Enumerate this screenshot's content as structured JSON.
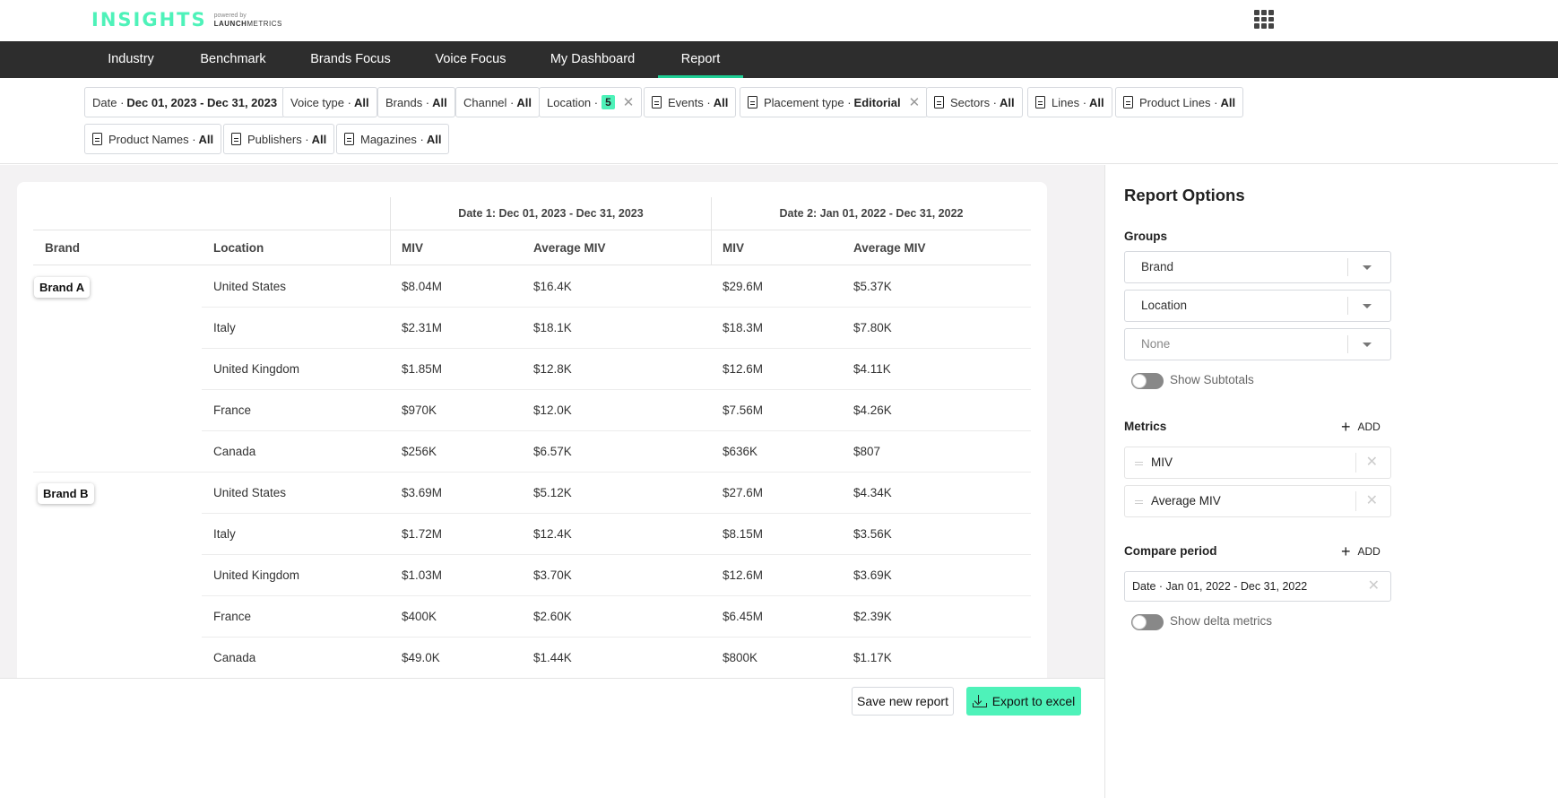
{
  "app": {
    "logo_word": "INSIGHTS",
    "logo_powered": "powered by",
    "logo_brand_bold": "LAUNCH",
    "logo_brand_light": "METRICS",
    "apps_icon": "grid-apps-icon"
  },
  "colors": {
    "accent": "#4ef2b9",
    "nav_active_underline": "#1fcf95",
    "nav_bg": "#2d2d2d"
  },
  "nav": {
    "items": [
      {
        "label": "Industry",
        "active": false
      },
      {
        "label": "Benchmark",
        "active": false
      },
      {
        "label": "Brands Focus",
        "active": false
      },
      {
        "label": "Voice Focus",
        "active": false
      },
      {
        "label": "My Dashboard",
        "active": false
      },
      {
        "label": "Report",
        "active": true
      }
    ]
  },
  "filters": [
    {
      "label": "Date ·",
      "value": "Dec 01, 2023 - Dec 31, 2023",
      "icon": null,
      "removable": false
    },
    {
      "label": "Voice type ·",
      "value": "All",
      "icon": null,
      "removable": false
    },
    {
      "label": "Brands ·",
      "value": "All",
      "icon": null,
      "removable": false
    },
    {
      "label": "Channel ·",
      "value": "All",
      "icon": null,
      "removable": false
    },
    {
      "label": "Location ·",
      "badge": "5",
      "icon": null,
      "removable": true
    },
    {
      "label": "Events ·",
      "value": "All",
      "icon": "document-icon",
      "removable": false
    },
    {
      "label": "Placement type ·",
      "value": "Editorial",
      "icon": "document-icon",
      "removable": true
    },
    {
      "label": "Sectors ·",
      "value": "All",
      "icon": "document-icon",
      "removable": false
    },
    {
      "label": "Lines ·",
      "value": "All",
      "icon": "document-icon",
      "removable": false
    },
    {
      "label": "Product Lines ·",
      "value": "All",
      "icon": "document-icon",
      "removable": false
    },
    {
      "label": "Product Names ·",
      "value": "All",
      "icon": "document-icon",
      "removable": false
    },
    {
      "label": "Publishers ·",
      "value": "All",
      "icon": "document-icon",
      "removable": false
    },
    {
      "label": "Magazines ·",
      "value": "All",
      "icon": "document-icon",
      "removable": false
    }
  ],
  "table": {
    "period_headers": [
      "Date 1: Dec 01, 2023 - Dec 31, 2023",
      "Date 2: Jan 01, 2022 - Dec 31, 2022"
    ],
    "columns": [
      "Brand",
      "Location",
      "MIV",
      "Average MIV",
      "MIV",
      "Average MIV"
    ],
    "groups": [
      {
        "brand": "Brand A",
        "rows": [
          {
            "location": "United States",
            "miv1": "$8.04M",
            "avg1": "$16.4K",
            "miv2": "$29.6M",
            "avg2": "$5.37K"
          },
          {
            "location": "Italy",
            "miv1": "$2.31M",
            "avg1": "$18.1K",
            "miv2": "$18.3M",
            "avg2": "$7.80K"
          },
          {
            "location": "United Kingdom",
            "miv1": "$1.85M",
            "avg1": "$12.8K",
            "miv2": "$12.6M",
            "avg2": "$4.11K"
          },
          {
            "location": "France",
            "miv1": "$970K",
            "avg1": "$12.0K",
            "miv2": "$7.56M",
            "avg2": "$4.26K"
          },
          {
            "location": "Canada",
            "miv1": "$256K",
            "avg1": "$6.57K",
            "miv2": "$636K",
            "avg2": "$807"
          }
        ]
      },
      {
        "brand": "Brand B",
        "rows": [
          {
            "location": "United States",
            "miv1": "$3.69M",
            "avg1": "$5.12K",
            "miv2": "$27.6M",
            "avg2": "$4.34K"
          },
          {
            "location": "Italy",
            "miv1": "$1.72M",
            "avg1": "$12.4K",
            "miv2": "$8.15M",
            "avg2": "$3.56K"
          },
          {
            "location": "United Kingdom",
            "miv1": "$1.03M",
            "avg1": "$3.70K",
            "miv2": "$12.6M",
            "avg2": "$3.69K"
          },
          {
            "location": "France",
            "miv1": "$400K",
            "avg1": "$2.60K",
            "miv2": "$6.45M",
            "avg2": "$2.39K"
          },
          {
            "location": "Canada",
            "miv1": "$49.0K",
            "avg1": "$1.44K",
            "miv2": "$800K",
            "avg2": "$1.17K"
          }
        ]
      }
    ]
  },
  "footer": {
    "save_label": "Save new report",
    "export_label": "Export to excel"
  },
  "sidebar": {
    "title": "Report Options",
    "groups_label": "Groups",
    "groups": [
      {
        "value": "Brand",
        "placeholder": false
      },
      {
        "value": "Location",
        "placeholder": false
      },
      {
        "value": "None",
        "placeholder": true
      }
    ],
    "show_subtotals_label": "Show Subtotals",
    "show_subtotals_on": false,
    "metrics_label": "Metrics",
    "add_label": "ADD",
    "metrics": [
      "MIV",
      "Average MIV"
    ],
    "compare_label": "Compare period",
    "compare_value": "Date · Jan 01, 2022 - Dec 31, 2022",
    "show_delta_label": "Show delta metrics",
    "show_delta_on": false
  }
}
